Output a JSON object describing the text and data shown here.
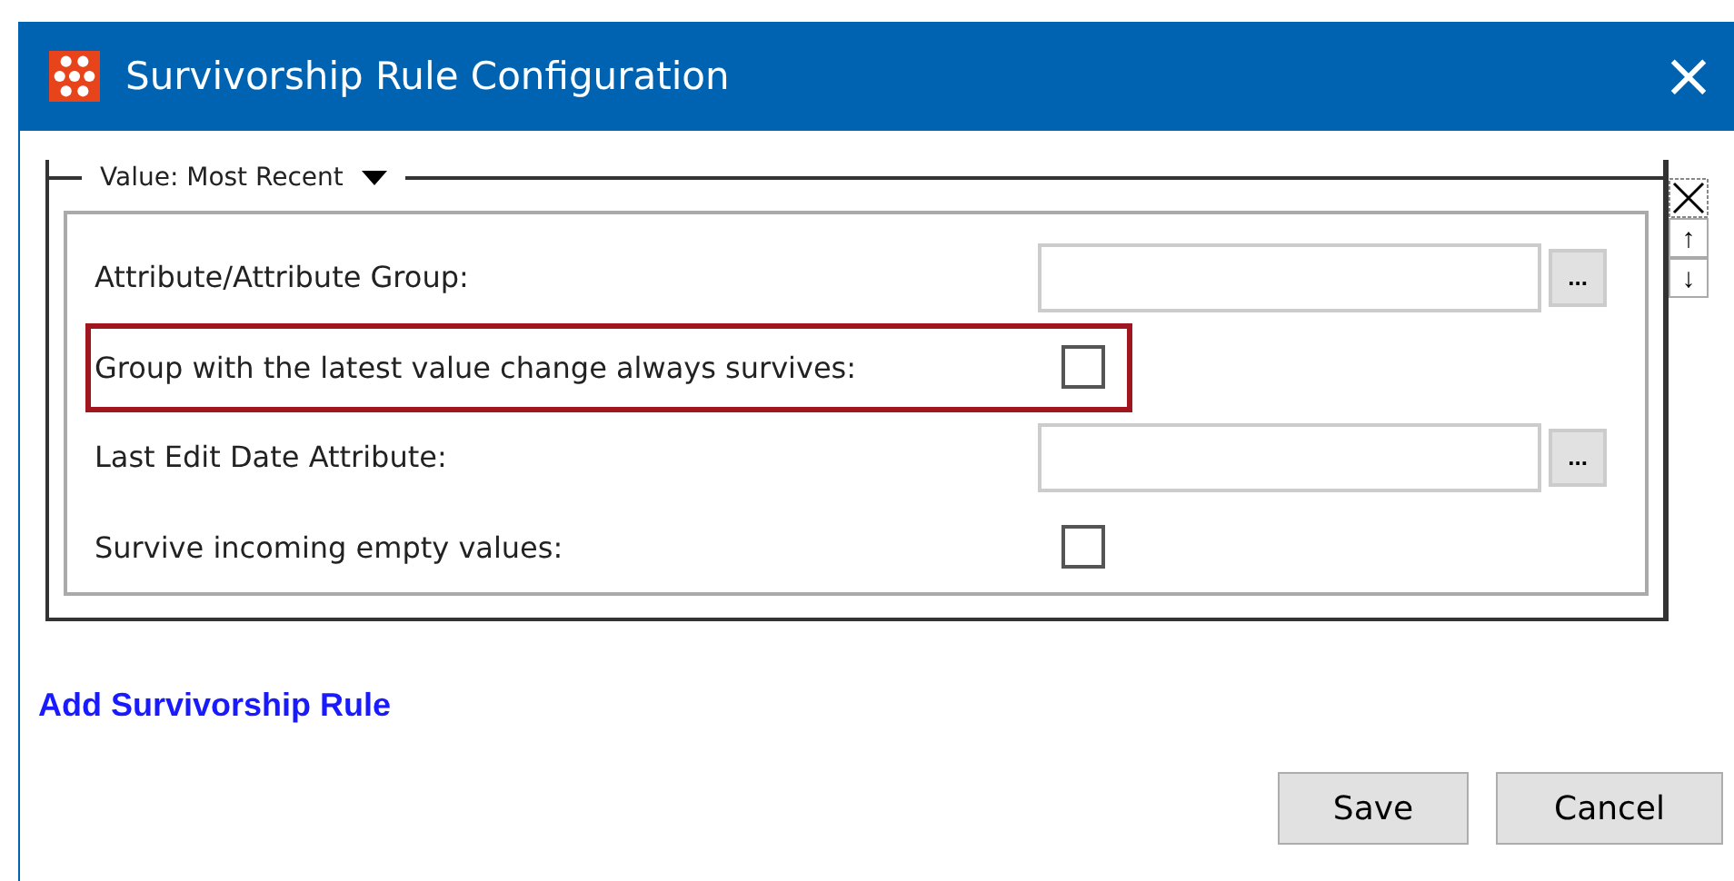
{
  "window": {
    "title": "Survivorship Rule Configuration",
    "close": "×"
  },
  "group": {
    "title": "Value: Most Recent",
    "rows": [
      {
        "kind": "field",
        "label": "Attribute/Attribute Group:",
        "browse": "...",
        "highlighted": false
      },
      {
        "kind": "checkbox",
        "label": "Group with the latest value change always survives:",
        "checked": false,
        "highlighted": true
      },
      {
        "kind": "field",
        "label": "Last Edit Date Attribute:",
        "browse": "...",
        "highlighted": false
      },
      {
        "kind": "checkbox",
        "label": "Survive incoming empty values:",
        "checked": false,
        "highlighted": false
      }
    ]
  },
  "side_controls": [
    "↑",
    "↓"
  ],
  "link": "Add Survivorship Rule",
  "buttons": [
    "Save",
    "Cancel"
  ]
}
